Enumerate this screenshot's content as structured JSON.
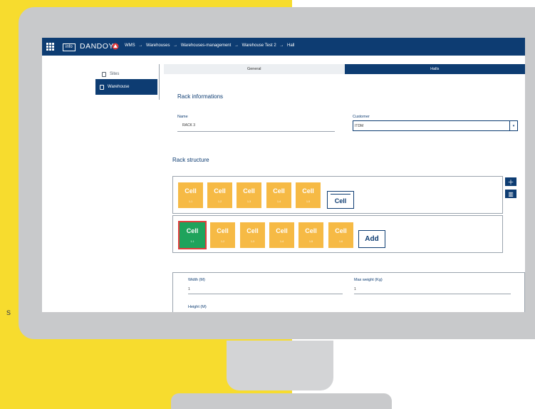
{
  "stray_text": "s",
  "topbar": {
    "info_badge": "info",
    "brand": "DANDOY",
    "breadcrumb": [
      "WMS",
      "→",
      "Warehouses",
      "→",
      "Warehouses-management",
      "→",
      "Warehouse Test 2",
      "→",
      "Hall"
    ]
  },
  "sidebar": {
    "items": [
      {
        "label": "Sites",
        "icon": "building-icon"
      },
      {
        "label": "Warehouse",
        "icon": "warehouse-icon",
        "active": true
      }
    ]
  },
  "tabs": [
    {
      "label": "General"
    },
    {
      "label": "Halls",
      "active": true
    }
  ],
  "rack_info": {
    "title": "Rack informations",
    "name_label": "Name",
    "name_value": "RACK 3",
    "customer_label": "Customer",
    "customer_value": "ITDM"
  },
  "rack_structure": {
    "title": "Rack structure",
    "rows": [
      {
        "cells": [
          {
            "label": "Cell",
            "sub": "1-1"
          },
          {
            "label": "Cell",
            "sub": "1-2"
          },
          {
            "label": "Cell",
            "sub": "1-3"
          },
          {
            "label": "Cell",
            "sub": "1-4"
          },
          {
            "label": "Cell",
            "sub": "1-5"
          }
        ],
        "action": "Cell"
      },
      {
        "cells": [
          {
            "label": "Cell",
            "sub": "1-1",
            "selected": true
          },
          {
            "label": "Cell",
            "sub": "1-2"
          },
          {
            "label": "Cell",
            "sub": "1-3"
          },
          {
            "label": "Cell",
            "sub": "1-4"
          },
          {
            "label": "Cell",
            "sub": "1-5"
          },
          {
            "label": "Cell",
            "sub": "1-6"
          }
        ],
        "action": "Add"
      }
    ],
    "add_row_icon": "plus-icon",
    "delete_row_icon": "trash-icon"
  },
  "dimensions": {
    "width_label": "Width (M)",
    "width_value": "1",
    "max_weight_label": "Max weight (Kg)",
    "max_weight_value": "1",
    "height_label": "Height (M)"
  },
  "colors": {
    "primary": "#0d3c72",
    "cell": "#f6ba45",
    "cell_selected": "#1fa35c",
    "selected_border": "#e23b3b",
    "background_yellow": "#f7dc2e",
    "monitor": "#c8c9cb"
  }
}
